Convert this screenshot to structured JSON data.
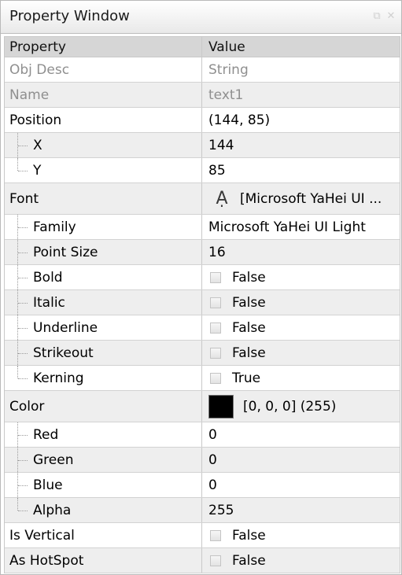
{
  "window": {
    "title": "Property Window"
  },
  "grid": {
    "header": {
      "property": "Property",
      "value": "Value"
    },
    "rows": [
      {
        "name": "Obj Desc",
        "value": "String"
      },
      {
        "name": "Name",
        "value": "text1"
      },
      {
        "name": "Position",
        "value": "(144, 85)"
      },
      {
        "name": "X",
        "value": "144"
      },
      {
        "name": "Y",
        "value": "85"
      },
      {
        "name": "Font",
        "value": "[Microsoft YaHei UI ...",
        "icon": "font-icon"
      },
      {
        "name": "Family",
        "value": "Microsoft YaHei UI Light"
      },
      {
        "name": "Point Size",
        "value": "16"
      },
      {
        "name": "Bold",
        "value": "False",
        "checked": false
      },
      {
        "name": "Italic",
        "value": "False",
        "checked": false
      },
      {
        "name": "Underline",
        "value": "False",
        "checked": false
      },
      {
        "name": "Strikeout",
        "value": "False",
        "checked": false
      },
      {
        "name": "Kerning",
        "value": "True",
        "checked": true
      },
      {
        "name": "Color",
        "value": "[0, 0, 0] (255)",
        "swatch": "#000000"
      },
      {
        "name": "Red",
        "value": "0"
      },
      {
        "name": "Green",
        "value": "0"
      },
      {
        "name": "Blue",
        "value": "0"
      },
      {
        "name": "Alpha",
        "value": "255"
      },
      {
        "name": "Is Vertical",
        "value": "False",
        "checked": false
      },
      {
        "name": "As HotSpot",
        "value": "False",
        "checked": false
      }
    ]
  },
  "colors": {
    "header_bg": "#d6d6d6",
    "alt_row_bg": "#eeeeee",
    "disabled_text": "#8f8f8f",
    "grid_line": "#c9c9c9"
  }
}
